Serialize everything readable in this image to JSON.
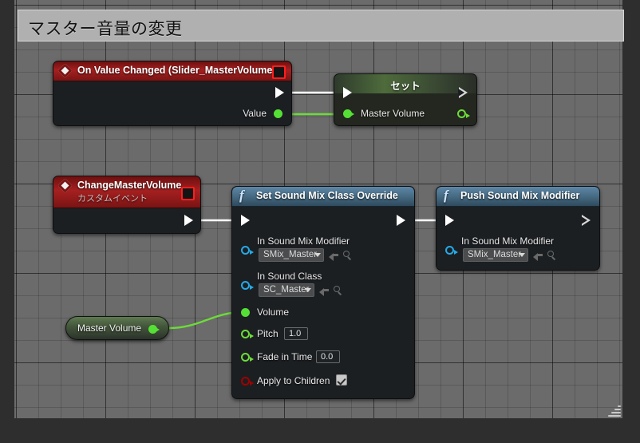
{
  "comment": {
    "title": "マスター音量の変更"
  },
  "nodes": {
    "on_value_changed": {
      "title": "On Value Changed (Slider_MasterVolume)",
      "icon": "event-diamond-icon",
      "delegate_pin": "delegate-pin",
      "exec_out": "exec-out-pin",
      "outputs": [
        {
          "label": "Value",
          "type": "float"
        }
      ]
    },
    "set_master_volume": {
      "title": "セット",
      "exec_in": "exec-in-pin",
      "exec_out": "exec-out-pin",
      "inputs": [
        {
          "label": "Master Volume",
          "type": "float"
        }
      ],
      "outputs": [
        {
          "label": "",
          "type": "float"
        }
      ]
    },
    "change_master_volume": {
      "title": "ChangeMasterVolume",
      "subtitle": "カスタムイベント",
      "icon": "event-diamond-icon",
      "delegate_pin": "delegate-pin",
      "exec_out": "exec-out-pin"
    },
    "set_sound_mix_class_override": {
      "title": "Set Sound Mix Class Override",
      "icon": "function-f-icon",
      "exec_in": "exec-in-pin",
      "exec_out": "exec-out-pin",
      "inputs": [
        {
          "label": "In Sound Mix Modifier",
          "type": "object",
          "value": "SMix_Master",
          "widget": "combo"
        },
        {
          "label": "In Sound Class",
          "type": "object",
          "value": "SC_Master",
          "widget": "combo"
        },
        {
          "label": "Volume",
          "type": "float",
          "value": "",
          "widget": "none"
        },
        {
          "label": "Pitch",
          "type": "float",
          "value": "1.0",
          "widget": "text"
        },
        {
          "label": "Fade in Time",
          "type": "float",
          "value": "0.0",
          "widget": "text"
        },
        {
          "label": "Apply to Children",
          "type": "bool",
          "value": "checked",
          "widget": "checkbox"
        }
      ]
    },
    "push_sound_mix_modifier": {
      "title": "Push Sound Mix Modifier",
      "icon": "function-f-icon",
      "exec_in": "exec-in-pin",
      "exec_out": "exec-out-pin",
      "inputs": [
        {
          "label": "In Sound Mix Modifier",
          "type": "object",
          "value": "SMix_Master",
          "widget": "combo"
        }
      ]
    },
    "master_volume_getter": {
      "title": "Master Volume",
      "type": "float",
      "output_pin": "value-out-pin"
    }
  },
  "colors": {
    "event_header": "#a62020",
    "function_header": "#44687f",
    "set_header": "#4e6b3c",
    "exec_wire": "#ffffff",
    "float_wire": "#6ddb3a",
    "float_pin": "#55e035",
    "object_pin": "#25a9e6",
    "bool_pin": "#a00000",
    "canvas": "#6b6b6b",
    "node_body": "#1c1f22",
    "comment_bg": "#b0b0b0"
  },
  "widgets": {
    "use_icon": "use-selected-asset-icon",
    "browse_icon": "browse-to-asset-icon",
    "dropdown_icon": "chevron-down-icon",
    "resize_grip": "resize-grip-handle"
  }
}
